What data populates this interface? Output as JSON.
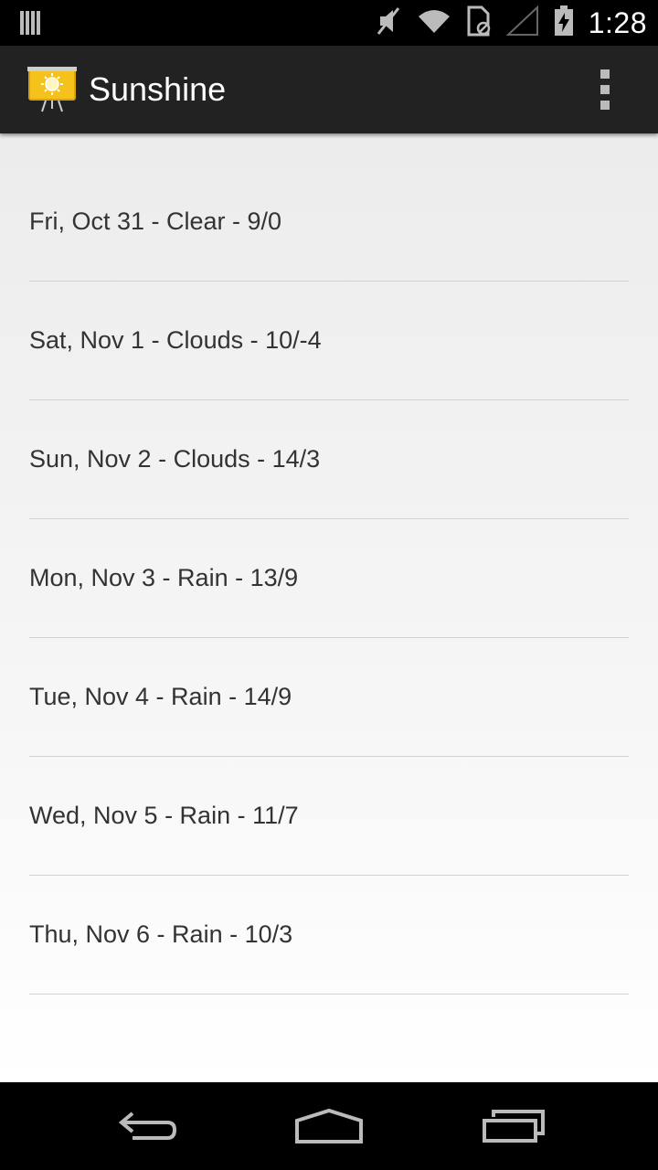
{
  "status_bar": {
    "time": "1:28",
    "icons": [
      "notification-icon",
      "mute-icon",
      "wifi-icon",
      "sim-icon",
      "signal-icon",
      "battery-charging-icon"
    ]
  },
  "action_bar": {
    "title": "Sunshine",
    "icon": "sunshine-app-icon",
    "menu_icon": "overflow-menu-icon",
    "bar_color": "#222222",
    "icon_accent": "#f5c21b"
  },
  "forecast": [
    "Fri, Oct 31 - Clear - 9/0",
    "Sat, Nov 1 - Clouds - 10/-4",
    "Sun, Nov 2 - Clouds - 14/3",
    "Mon, Nov 3 - Rain - 13/9",
    "Tue, Nov 4 - Rain - 14/9",
    "Wed, Nov 5 - Rain - 11/7",
    "Thu, Nov 6 - Rain - 10/3"
  ],
  "nav_bar": {
    "buttons": [
      "back-icon",
      "home-icon",
      "recent-apps-icon"
    ]
  }
}
